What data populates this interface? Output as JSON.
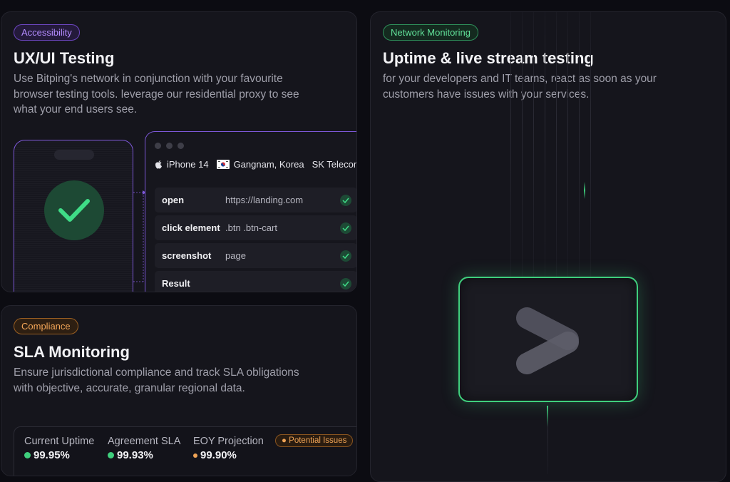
{
  "ux_card": {
    "badge": "Accessibility",
    "title": "UX/UI Testing",
    "description": "Use Bitping's network in conjunction with your favourite browser testing tools. leverage our residential proxy to see what your end users see.",
    "device": "iPhone 14",
    "location": "Gangnam, Korea",
    "carrier": "SK Telecom",
    "steps": [
      {
        "command": "open",
        "argument": "https://landing.com"
      },
      {
        "command": "click element",
        "argument": ".btn .btn-cart"
      },
      {
        "command": "screenshot",
        "argument": "page"
      },
      {
        "command": "Result",
        "argument": ""
      }
    ]
  },
  "sla_card": {
    "badge": "Compliance",
    "title": "SLA Monitoring",
    "description": "Ensure jurisdictional compliance and track SLA obligations with objective, accurate, granular regional data.",
    "stats": [
      {
        "label": "Current Uptime",
        "value": "99.95%",
        "color": "#3fcf7d"
      },
      {
        "label": "Agreement SLA",
        "value": "99.93%",
        "color": "#3fcf7d"
      },
      {
        "label": "EOY Projection",
        "value": "99.90%",
        "color": "#f0a456"
      }
    ],
    "issues_badge": "Potential Issues"
  },
  "uptime_card": {
    "badge": "Network Monitoring",
    "title": "Uptime & live stream testing",
    "description": "for your developers and IT teams, react as soon as your customers have issues with your services."
  },
  "colors": {
    "accent_purple": "#7d58d8",
    "accent_green": "#3fcf7d",
    "accent_orange": "#f0a456"
  }
}
